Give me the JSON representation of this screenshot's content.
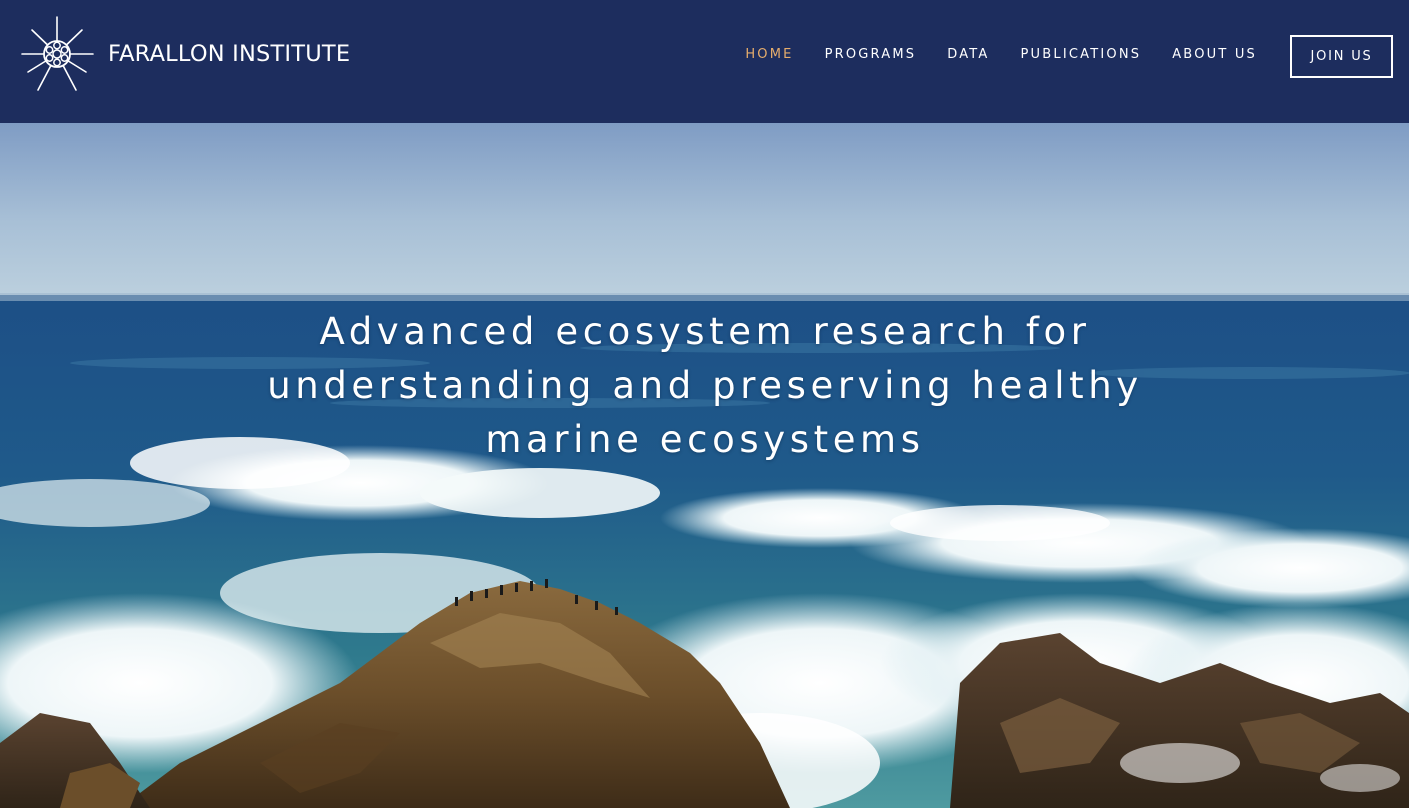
{
  "header": {
    "logo_text": "FARALLON INSTITUTE",
    "logo_icon": "starburst-radiolarian-logo",
    "background_color": "#1d2d5e"
  },
  "nav": {
    "items": [
      {
        "label": "HOME",
        "active": true
      },
      {
        "label": "PROGRAMS",
        "active": false
      },
      {
        "label": "DATA",
        "active": false
      },
      {
        "label": "PUBLICATIONS",
        "active": false
      },
      {
        "label": "ABOUT US",
        "active": false
      }
    ],
    "active_color": "#e6ad6c",
    "join_label": "JOIN US"
  },
  "hero": {
    "headline": "Advanced ecosystem research for understanding and preserving healthy marine ecosystems",
    "image_description_icon": "ocean-waves-rocky-coast-photo"
  }
}
